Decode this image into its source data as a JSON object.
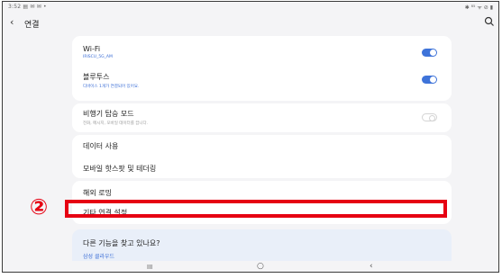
{
  "status_bar": {
    "left": "3:52 ▤ ✉ ✉ •",
    "right": "✱ ⁸⁵ ᯤ ⊘ ▮"
  },
  "header": {
    "back_icon": "chevron-left-icon",
    "title": "연결",
    "search_icon": "search-icon"
  },
  "rows": {
    "wifi": {
      "label": "Wi-Fi",
      "sub": "IRISCU_5G_AM",
      "toggle": "on"
    },
    "bluetooth": {
      "label": "블루투스",
      "sub": "디바이스 1개가 연결되어 있어요.",
      "toggle": "on"
    },
    "airplane": {
      "label": "비행기 탑승 모드",
      "sub": "전화, 메시지, 모바일 데이터를 끕니다.",
      "toggle": "off"
    },
    "data_usage": {
      "label": "데이터 사용"
    },
    "hotspot": {
      "label": "모바일 핫스팟 및 테더링"
    },
    "roaming": {
      "label": "해외 로밍"
    },
    "other": {
      "label": "기타 연결 설정"
    }
  },
  "annotation": {
    "marker": "②",
    "color": "#e60012"
  },
  "callout": {
    "title": "다른 기능을 찾고 있나요?",
    "link": "삼성 클라우드"
  },
  "navbar": {
    "recent": "III",
    "home": "○",
    "back": "‹"
  },
  "colors": {
    "accent": "#3e73d9",
    "background": "#f4f4f6",
    "card": "#ffffff",
    "highlight": "#e60012"
  }
}
